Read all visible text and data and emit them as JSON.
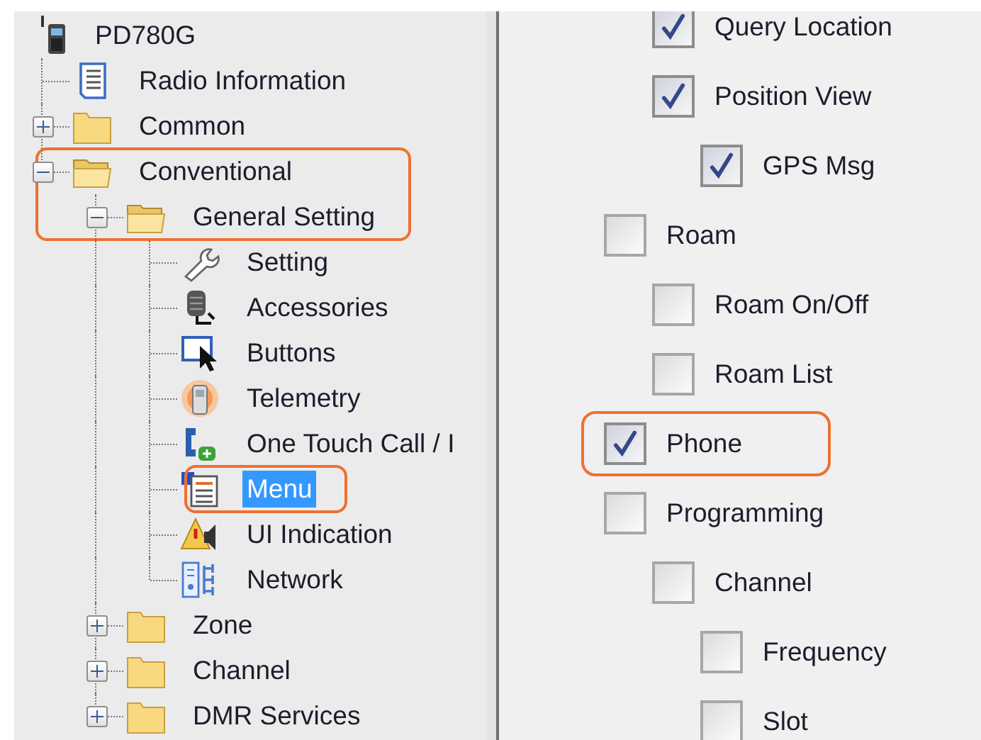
{
  "tree": {
    "label": "PD780G",
    "kind": "device",
    "selected": false,
    "children": [
      {
        "label": "Radio Information",
        "kind": "document",
        "selected": false,
        "outlined": false
      },
      {
        "label": "Common",
        "kind": "folder",
        "expanded": false,
        "selected": false,
        "outlined": false
      },
      {
        "label": "Conventional",
        "kind": "folder",
        "expanded": true,
        "selected": false,
        "outlined": true,
        "children": [
          {
            "label": "General Setting",
            "kind": "folder",
            "expanded": true,
            "selected": false,
            "outlined": true,
            "children": [
              {
                "label": "Setting",
                "kind": "wrench",
                "selected": false,
                "outlined": false
              },
              {
                "label": "Accessories",
                "kind": "microphone",
                "selected": false,
                "outlined": false
              },
              {
                "label": "Buttons",
                "kind": "cursor",
                "selected": false,
                "outlined": false
              },
              {
                "label": "Telemetry",
                "kind": "signal",
                "selected": false,
                "outlined": false
              },
              {
                "label": "One Touch Call / I",
                "kind": "call",
                "selected": false,
                "outlined": false
              },
              {
                "label": "Menu",
                "kind": "menu",
                "selected": true,
                "outlined": true
              },
              {
                "label": "UI Indication",
                "kind": "alert",
                "selected": false,
                "outlined": false
              },
              {
                "label": "Network",
                "kind": "network",
                "selected": false,
                "outlined": false
              }
            ]
          },
          {
            "label": "Zone",
            "kind": "folder",
            "expanded": false,
            "selected": false,
            "outlined": false
          },
          {
            "label": "Channel",
            "kind": "folder",
            "expanded": false,
            "selected": false,
            "outlined": false
          },
          {
            "label": "DMR Services",
            "kind": "folder",
            "expanded": false,
            "selected": false,
            "outlined": false
          }
        ]
      }
    ]
  },
  "continued_from_above": {
    "children": [
      {
        "children": [
          {
            "label": "Query Location",
            "checked": true,
            "outlined": false
          },
          {
            "label": "Position View",
            "checked": true,
            "outlined": false,
            "children": [
              {
                "label": "GPS Msg",
                "checked": true,
                "outlined": false
              }
            ]
          }
        ]
      }
    ]
  },
  "options": [
    {
      "label": "Roam",
      "checked": false,
      "outlined": false,
      "children": [
        {
          "label": "Roam On/Off",
          "checked": false,
          "outlined": false
        },
        {
          "label": "Roam List",
          "checked": false,
          "outlined": false
        }
      ]
    },
    {
      "label": "Phone",
      "checked": true,
      "outlined": true
    },
    {
      "label": "Programming",
      "checked": false,
      "outlined": false,
      "children": [
        {
          "label": "Channel",
          "checked": false,
          "outlined": false,
          "children": [
            {
              "label": "Frequency",
              "checked": false,
              "outlined": false
            },
            {
              "label": "Slot",
              "checked": false,
              "outlined": false
            }
          ]
        }
      ]
    }
  ]
}
